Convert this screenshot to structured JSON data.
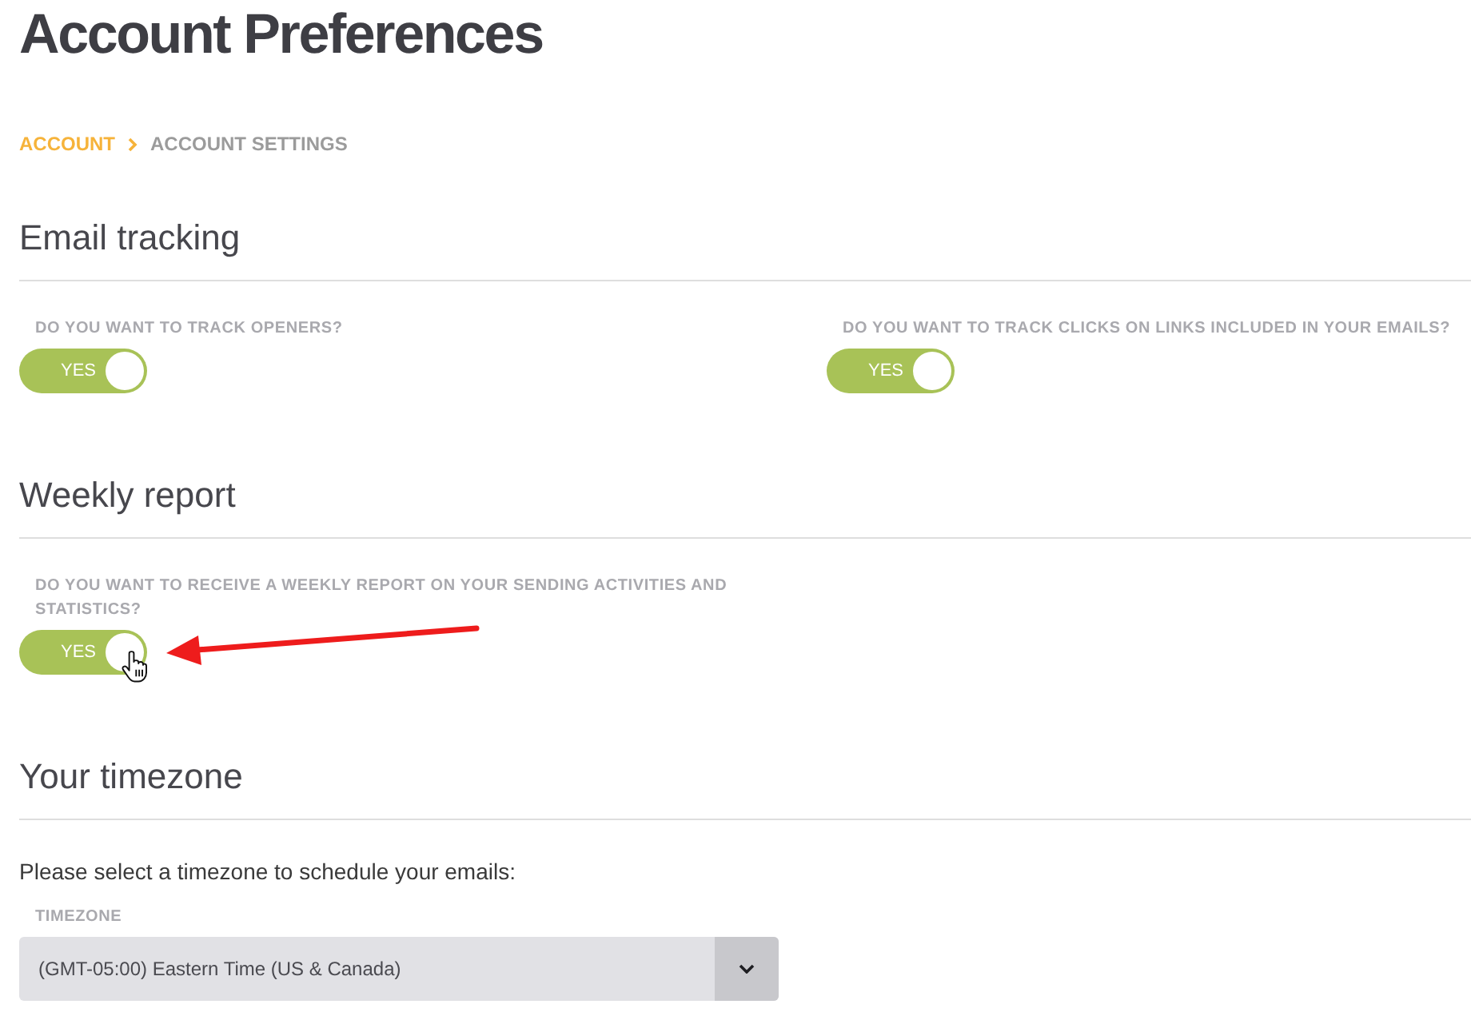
{
  "page": {
    "title": "Account Preferences"
  },
  "breadcrumb": [
    {
      "label": "ACCOUNT",
      "current": false
    },
    {
      "label": "ACCOUNT SETTINGS",
      "current": true
    }
  ],
  "sections": [
    {
      "kind": "toggles",
      "title": "Email tracking",
      "settings": [
        {
          "question": "DO YOU WANT TO TRACK OPENERS?",
          "toggle": {
            "label": "YES",
            "on": true
          },
          "pointed_at": false
        },
        {
          "question": "DO YOU WANT TO TRACK CLICKS ON LINKS INCLUDED IN YOUR EMAILS?",
          "toggle": {
            "label": "YES",
            "on": true
          },
          "pointed_at": false
        }
      ]
    },
    {
      "kind": "toggles",
      "title": "Weekly report",
      "settings": [
        {
          "question": "DO YOU WANT TO RECEIVE A WEEKLY REPORT ON YOUR SENDING ACTIVITIES AND STATISTICS?",
          "toggle": {
            "label": "YES",
            "on": true
          },
          "pointed_at": true
        }
      ]
    },
    {
      "kind": "timezone",
      "title": "Your timezone",
      "intro": "Please select a timezone to schedule your emails:",
      "select": {
        "label": "TIMEZONE",
        "value": "(GMT-05:00) Eastern Time (US & Canada)"
      }
    }
  ]
}
